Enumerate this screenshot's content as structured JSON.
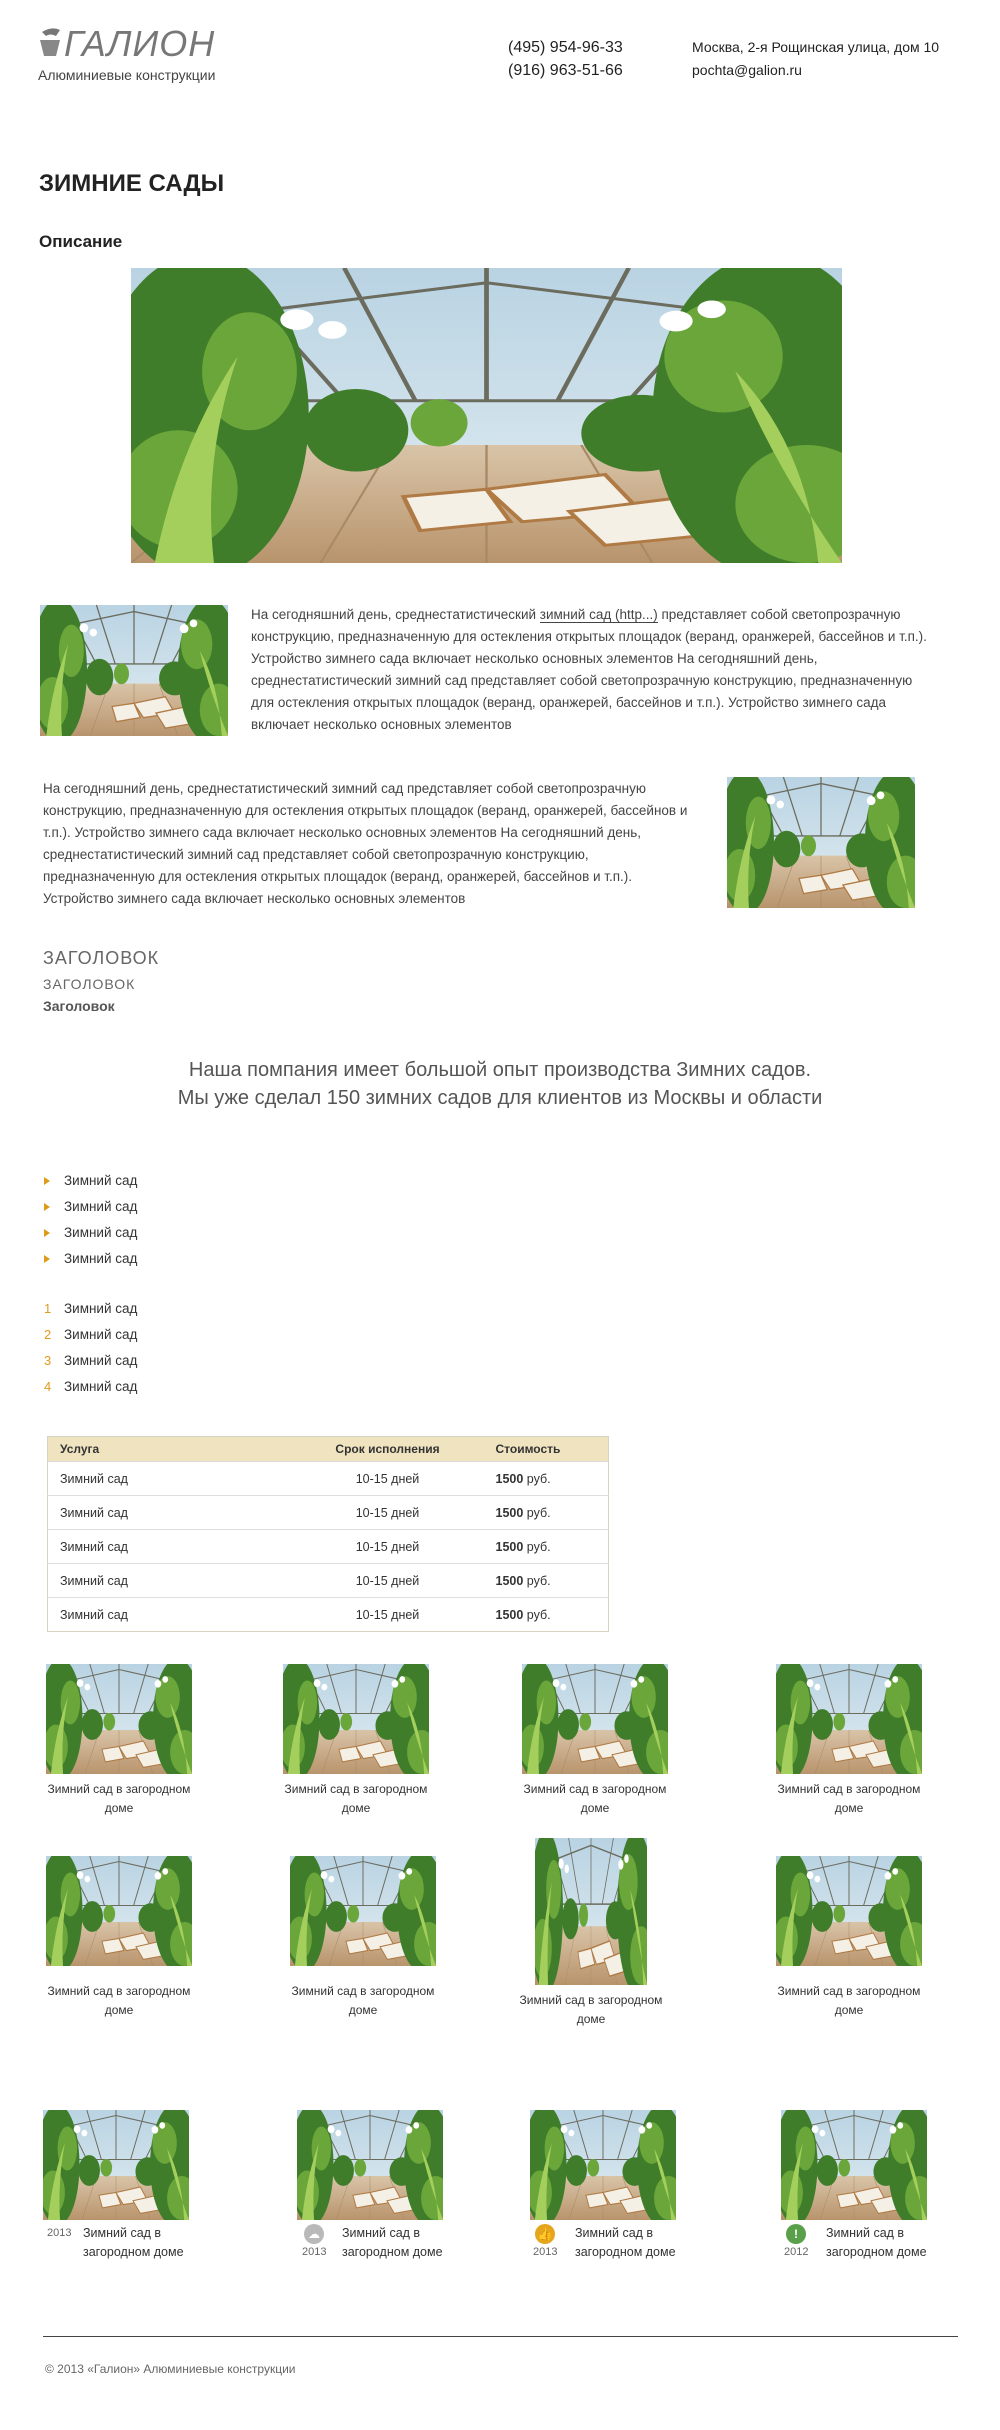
{
  "header": {
    "logo_text": "ГАЛИОН",
    "logo_sub": "Алюминиевые конструкции",
    "phone1": "(495) 954-96-33",
    "phone2": "(916) 963-51-66",
    "address": "Москва, 2-я Рощинская улица, дом 10",
    "email": "pochta@galion.ru"
  },
  "page_title": "ЗИМНИЕ САДЫ",
  "section_title": "Описание",
  "para1": {
    "before": "На сегодняшний день, среднестатистический ",
    "link": "зимний сад (http...)",
    "after": " представляет собой светопрозрачную конструкцию, предназначенную для остекления открытых площадок (веранд, оранжерей, бассейнов и т.п.). Устройство зимнего сада включает несколько основных элементов На сегодняшний день, среднестатистический зимний сад представляет собой светопрозрачную конструкцию, предназначенную для остекления открытых площадок (веранд, оранжерей, бассейнов и т.п.). Устройство зимнего сада включает несколько основных элементов"
  },
  "para2": "На сегодняшний день, среднестатистический зимний сад представляет собой светопрозрачную конструкцию, предназначенную для остекления открытых площадок (веранд, оранжерей, бассейнов и т.п.). Устройство зимнего сада включает несколько основных элементов На сегодняшний день, среднестатистический зимний сад представляет собой светопрозрачную конструкцию, предназначенную для остекления открытых площадок (веранд, оранжерей, бассейнов и т.п.). Устройство зимнего сада включает несколько основных элементов",
  "headings": {
    "h_a": "ЗАГОЛОВОК",
    "h_b": "ЗАГОЛОВОК",
    "h_c": "Заголовок"
  },
  "quote": {
    "line1": "Наша помпания имеет большой опыт производства Зимних садов.",
    "line2": "Мы уже сделал 150 зимних садов для клиентов из Москвы и области"
  },
  "bullet_list": [
    "Зимний сад",
    "Зимний сад",
    "Зимний сад",
    "Зимний сад"
  ],
  "numbered_list": [
    {
      "num": "1",
      "text": "Зимний сад"
    },
    {
      "num": "2",
      "text": "Зимний сад"
    },
    {
      "num": "3",
      "text": "Зимний сад"
    },
    {
      "num": "4",
      "text": "Зимний сад"
    }
  ],
  "table": {
    "headers": [
      "Услуга",
      "Срок исполнения",
      "Стоимость"
    ],
    "rows": [
      {
        "service": "Зимний сад",
        "term": "10-15 дней",
        "price": "1500",
        "unit": "руб."
      },
      {
        "service": "Зимний сад",
        "term": "10-15 дней",
        "price": "1500",
        "unit": "руб."
      },
      {
        "service": "Зимний сад",
        "term": "10-15 дней",
        "price": "1500",
        "unit": "руб."
      },
      {
        "service": "Зимний сад",
        "term": "10-15 дней",
        "price": "1500",
        "unit": "руб."
      },
      {
        "service": "Зимний сад",
        "term": "10-15 дней",
        "price": "1500",
        "unit": "руб."
      }
    ]
  },
  "gallery1": {
    "cap_line1": "Зимний сад в загородном",
    "cap_line2": "доме"
  },
  "gallery3": [
    {
      "year": "2013",
      "line1": "Зимний сад в",
      "line2": "загородном доме",
      "icon": "none"
    },
    {
      "year": "2013",
      "line1": "Зимний сад в",
      "line2": "загородном доме",
      "icon": "cloud-icon",
      "icon_color": "#b9b9b9"
    },
    {
      "year": "2013",
      "line1": "Зимний сад в",
      "line2": "загородном доме",
      "icon": "thumbs-up-icon",
      "icon_color": "#e5a51c"
    },
    {
      "year": "2012",
      "line1": "Зимний сад в",
      "line2": "загородном доме",
      "icon": "exclamation-icon",
      "icon_color": "#5aa04a"
    }
  ],
  "footer": "© 2013  «Галион»  Алюминиевые конструкции"
}
